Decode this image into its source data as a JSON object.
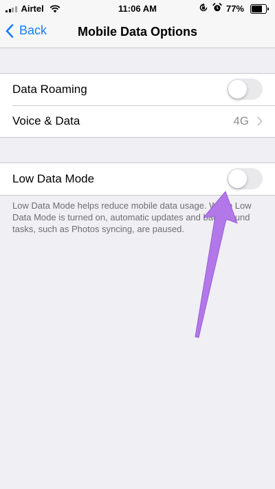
{
  "status_bar": {
    "carrier": "Airtel",
    "time": "11:06 AM",
    "battery_percent": "77%",
    "battery_level": 0.77,
    "icons": [
      "signal-icon",
      "wifi-icon",
      "orientation-lock-icon",
      "alarm-icon",
      "battery-icon"
    ]
  },
  "nav": {
    "back_label": "Back",
    "title": "Mobile Data Options"
  },
  "group1": {
    "items": [
      {
        "label": "Data Roaming",
        "control": "toggle",
        "on": false
      },
      {
        "label": "Voice & Data",
        "value": "4G",
        "control": "chevron"
      }
    ]
  },
  "group2": {
    "items": [
      {
        "label": "Low Data Mode",
        "control": "toggle",
        "on": false
      }
    ],
    "footer": "Low Data Mode helps reduce mobile data usage. When Low Data Mode is turned on, automatic updates and background tasks, such as Photos syncing, are paused."
  },
  "colors": {
    "accent": "#147efb",
    "background": "#efeff4",
    "toggle_off": "#e9e9eb",
    "annotation_arrow": "#b277e8"
  }
}
